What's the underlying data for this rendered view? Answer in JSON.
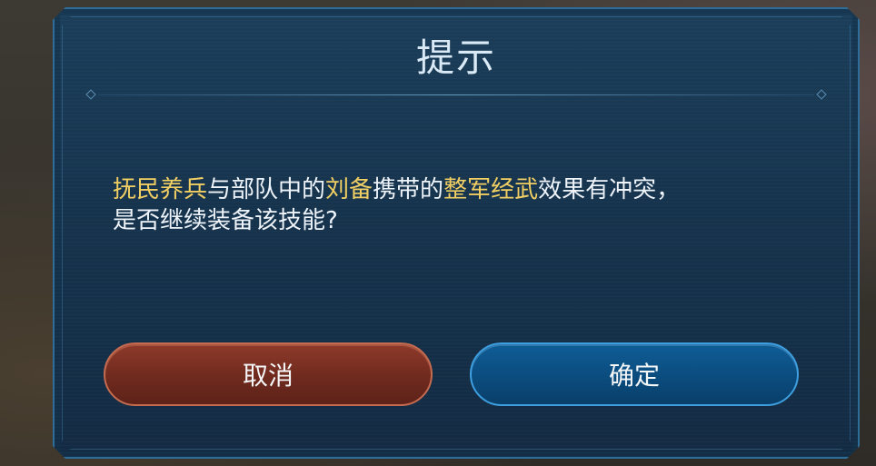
{
  "dialog": {
    "title": "提示",
    "message": {
      "line1": [
        {
          "text": "抚民养兵",
          "highlight": true
        },
        {
          "text": "与部队中的",
          "highlight": false
        },
        {
          "text": "刘备",
          "highlight": true
        },
        {
          "text": "携带的",
          "highlight": false
        },
        {
          "text": "整军经武",
          "highlight": true
        },
        {
          "text": "效果有冲突，",
          "highlight": false
        }
      ],
      "line2": "是否继续装备该技能?"
    },
    "buttons": {
      "cancel_label": "取消",
      "confirm_label": "确定"
    }
  },
  "colors": {
    "highlight": "#f2cf63",
    "text": "#eef4fa",
    "cancel": "#7a2f22",
    "confirm": "#0c5287",
    "panel": "#17354f"
  }
}
